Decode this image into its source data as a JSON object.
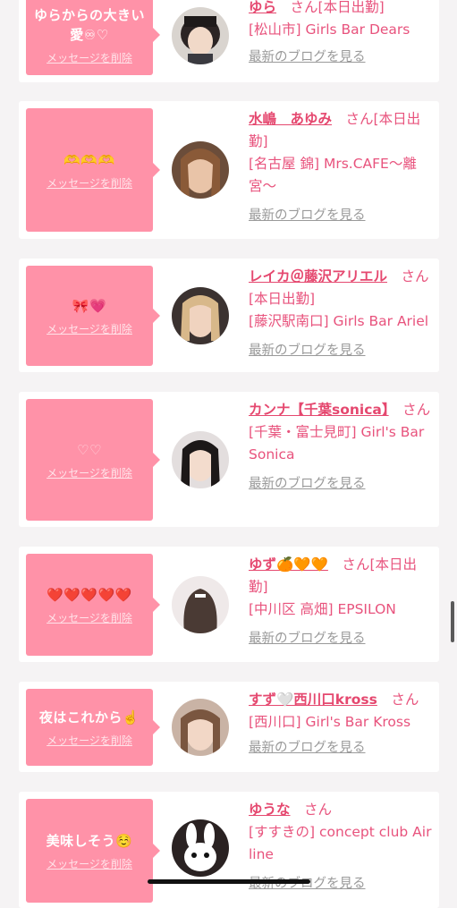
{
  "delete_label": "メッセージを削除",
  "blog_label": "最新のブログを見る",
  "cards": [
    {
      "message": "ゆらからの大きい愛♾♡",
      "name": "ゆら",
      "san": "さん",
      "status": "[本日出勤]",
      "shop": "[松山市] Girls Bar Dears"
    },
    {
      "message": "🫶🫶🫶",
      "name": "水嶋　あゆみ",
      "san": "さん",
      "status": "[本日出勤]",
      "shop": "[名古屋 錦] Mrs.CAFE〜離宮〜"
    },
    {
      "message": "🎀💗",
      "name": "レイカ＠藤沢アリエル",
      "san": "さん",
      "status": "[本日出勤]",
      "shop": "[藤沢駅南口] Girls Bar Ariel"
    },
    {
      "message": "♡♡",
      "name": "カンナ【千葉sonica】",
      "san": "さん",
      "status": "",
      "shop": "[千葉・富士見町] Girl's Bar Sonica"
    },
    {
      "message": "❤️❤️❤️❤️❤️",
      "name": "ゆず🍊🧡🧡",
      "san": "さん",
      "status": "[本日出勤]",
      "shop": "[中川区 高畑] EPSILON"
    },
    {
      "message": "夜はこれから☝️",
      "name": "すず🤍西川口kross",
      "san": "さん",
      "status": "",
      "shop": "[西川口] Girl's Bar Kross"
    },
    {
      "message": "美味しそう☺️",
      "name": "ゆうな",
      "san": "さん",
      "status": "",
      "shop": "[すすきの] concept club Air line"
    }
  ]
}
